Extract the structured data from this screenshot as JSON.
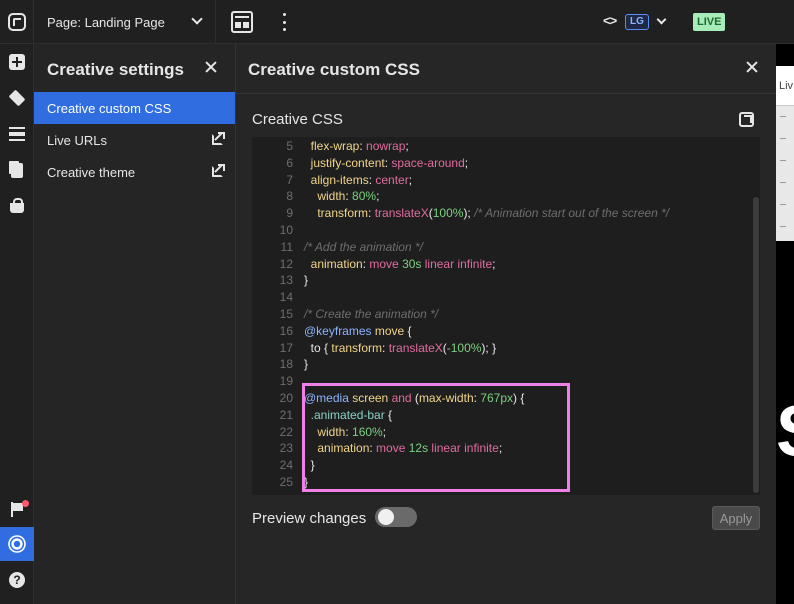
{
  "topbar": {
    "page_label": "Page: Landing Page",
    "code_icon_text": "<>",
    "breakpoint": "LG",
    "live_badge": "LIVE"
  },
  "rail": {
    "icons": [
      "add-icon",
      "layers-icon",
      "sections-icon",
      "pages-icon",
      "shopping-bag-icon",
      "flag-icon",
      "gear-icon",
      "help-icon"
    ],
    "help_glyph": "?"
  },
  "settings": {
    "title": "Creative settings",
    "items": [
      {
        "label": "Creative custom CSS",
        "active": true,
        "external": false
      },
      {
        "label": "Live URLs",
        "active": false,
        "external": true
      },
      {
        "label": "Creative theme",
        "active": false,
        "external": true
      }
    ]
  },
  "css_panel": {
    "title": "Creative custom CSS",
    "section_label": "Creative CSS",
    "preview_label": "Preview changes",
    "preview_enabled": false,
    "apply_label": "Apply"
  },
  "code_lines": [
    {
      "n": "5",
      "t": [
        [
          "  ",
          ""
        ],
        [
          "flex-wrap",
          "c-key"
        ],
        [
          ": ",
          ""
        ],
        [
          "nowrap",
          "c-val"
        ],
        [
          ";",
          ""
        ]
      ]
    },
    {
      "n": "6",
      "t": [
        [
          "  ",
          ""
        ],
        [
          "justify-content",
          "c-key"
        ],
        [
          ": ",
          ""
        ],
        [
          "space-around",
          "c-val"
        ],
        [
          ";",
          ""
        ]
      ]
    },
    {
      "n": "7",
      "t": [
        [
          "  ",
          ""
        ],
        [
          "align-items",
          "c-key"
        ],
        [
          ": ",
          ""
        ],
        [
          "center",
          "c-val"
        ],
        [
          ";",
          ""
        ]
      ]
    },
    {
      "n": "8",
      "t": [
        [
          "    ",
          ""
        ],
        [
          "width",
          "c-key"
        ],
        [
          ": ",
          ""
        ],
        [
          "80%",
          "c-num"
        ],
        [
          ";",
          ""
        ]
      ]
    },
    {
      "n": "9",
      "t": [
        [
          "    ",
          ""
        ],
        [
          "transform",
          "c-key"
        ],
        [
          ": ",
          ""
        ],
        [
          "translateX",
          "c-val"
        ],
        [
          "(",
          ""
        ],
        [
          "100%",
          "c-num"
        ],
        [
          "); ",
          ""
        ],
        [
          "/* Animation start out of the screen */",
          "c-com"
        ]
      ]
    },
    {
      "n": "10",
      "t": []
    },
    {
      "n": "11",
      "t": [
        [
          "/* Add the animation */",
          "c-com"
        ]
      ]
    },
    {
      "n": "12",
      "t": [
        [
          "  ",
          ""
        ],
        [
          "animation",
          "c-key"
        ],
        [
          ": ",
          ""
        ],
        [
          "move ",
          "c-val"
        ],
        [
          "30s",
          "c-num"
        ],
        [
          " linear infinite",
          "c-val"
        ],
        [
          ";",
          ""
        ]
      ]
    },
    {
      "n": "13",
      "t": [
        [
          "}",
          ""
        ]
      ]
    },
    {
      "n": "14",
      "t": []
    },
    {
      "n": "15",
      "t": [
        [
          "/* Create the animation */",
          "c-com"
        ]
      ]
    },
    {
      "n": "16",
      "t": [
        [
          "@keyframes",
          "c-at"
        ],
        [
          " ",
          ""
        ],
        [
          "move",
          "c-key"
        ],
        [
          " {",
          ""
        ]
      ]
    },
    {
      "n": "17",
      "t": [
        [
          "  to { ",
          ""
        ],
        [
          "transform",
          "c-key"
        ],
        [
          ": ",
          ""
        ],
        [
          "translateX",
          "c-val"
        ],
        [
          "(",
          ""
        ],
        [
          "-100%",
          "c-num"
        ],
        [
          "); }",
          ""
        ]
      ]
    },
    {
      "n": "18",
      "t": [
        [
          "}",
          ""
        ]
      ]
    },
    {
      "n": "19",
      "t": []
    },
    {
      "n": "20",
      "t": [
        [
          "@media",
          "c-at"
        ],
        [
          " screen ",
          "c-key"
        ],
        [
          "and",
          "c-val"
        ],
        [
          " (",
          ""
        ],
        [
          "max-width",
          "c-key"
        ],
        [
          ": ",
          ""
        ],
        [
          "767px",
          "c-num"
        ],
        [
          ") {",
          ""
        ]
      ]
    },
    {
      "n": "21",
      "t": [
        [
          "  ",
          ""
        ],
        [
          ".animated-bar",
          "c-sel"
        ],
        [
          " {",
          ""
        ]
      ]
    },
    {
      "n": "22",
      "t": [
        [
          "    ",
          ""
        ],
        [
          "width",
          "c-key"
        ],
        [
          ": ",
          ""
        ],
        [
          "160%",
          "c-num"
        ],
        [
          ";",
          ""
        ]
      ]
    },
    {
      "n": "23",
      "t": [
        [
          "    ",
          ""
        ],
        [
          "animation",
          "c-key"
        ],
        [
          ": ",
          ""
        ],
        [
          "move ",
          "c-val"
        ],
        [
          "12s",
          "c-num"
        ],
        [
          " linear infinite",
          "c-val"
        ],
        [
          ";",
          ""
        ]
      ]
    },
    {
      "n": "24",
      "t": [
        [
          "  }",
          ""
        ]
      ]
    },
    {
      "n": "25",
      "t": [
        [
          "}",
          ""
        ]
      ]
    }
  ],
  "preview_strip": {
    "top_text": "Liv",
    "big_glyph": "S"
  }
}
